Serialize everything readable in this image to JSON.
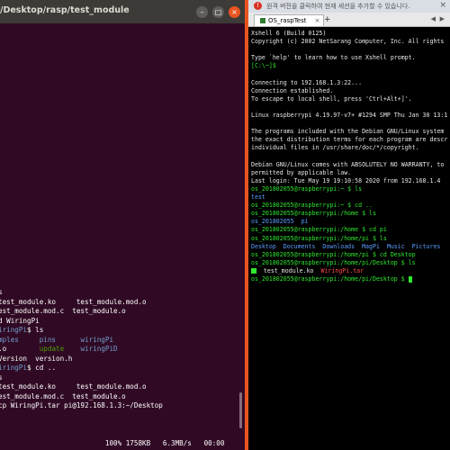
{
  "left_window": {
    "title": "/Desktop/rasp/test_module",
    "buttons": {
      "minimize": "–",
      "maximize": "□",
      "close": "×"
    }
  },
  "left_terminal": {
    "lines": [
      [
        {
          "t": "s",
          "c": "white"
        }
      ],
      [
        {
          "t": "test_module.ko     test_module.mod.o",
          "c": "white"
        }
      ],
      [
        {
          "t": "est_module.mod.c  test_module.o",
          "c": "white"
        }
      ],
      [
        {
          "t": "d WiringPi",
          "c": "white"
        }
      ],
      [
        {
          "t": "iringPi",
          "c": "blue"
        },
        {
          "t": "$ ls",
          "c": "white"
        }
      ],
      [
        {
          "t": "mples",
          "c": "blue"
        },
        {
          "t": "     ",
          "c": "white"
        },
        {
          "t": "pins",
          "c": "blue"
        },
        {
          "t": "      ",
          "c": "white"
        },
        {
          "t": "wiringPi",
          "c": "blue"
        }
      ],
      [
        {
          "t": ".o",
          "c": "white"
        },
        {
          "t": "        ",
          "c": "white"
        },
        {
          "t": "update",
          "c": "green"
        },
        {
          "t": "    ",
          "c": "white"
        },
        {
          "t": "wiringPiD",
          "c": "blue"
        }
      ],
      [
        {
          "t": "Version  version.h",
          "c": "white"
        }
      ],
      [
        {
          "t": "iringPi",
          "c": "blue"
        },
        {
          "t": "$ cd ..",
          "c": "white"
        }
      ],
      [
        {
          "t": "s",
          "c": "white"
        }
      ],
      [
        {
          "t": "test_module.ko     test_module.mod.o",
          "c": "white"
        }
      ],
      [
        {
          "t": "est_module.mod.c  test_module.o",
          "c": "white"
        }
      ],
      [
        {
          "t": "cp WiringPi.tar pi@192.168.1.3:~/Desktop",
          "c": "white"
        }
      ],
      [
        {
          "t": "",
          "c": "white"
        }
      ],
      [
        {
          "t": "                          100% 1758KB   6.3MB/s   00:00",
          "c": "white"
        }
      ]
    ]
  },
  "right_window": {
    "notice": "원격 버전을 클릭하여 현재 세션을 추가할 수 있습니다.",
    "tab_label": "OS_raspTest",
    "tab_close": "×",
    "tab_add": "+",
    "nav_left": "◀",
    "nav_right": "▶",
    "notice_close": "×"
  },
  "right_terminal": {
    "lines": [
      [
        {
          "t": "Xshell 6 (Build 0125)",
          "c": "white"
        }
      ],
      [
        {
          "t": "Copyright (c) 2002 NetSarang Computer, Inc. All rights",
          "c": "white"
        }
      ],
      [
        {
          "t": "",
          "c": "white"
        }
      ],
      [
        {
          "t": "Type `help' to learn how to use Xshell prompt.",
          "c": "white"
        }
      ],
      [
        {
          "t": "[C:\\~]$",
          "c": "green"
        }
      ],
      [
        {
          "t": "",
          "c": "white"
        }
      ],
      [
        {
          "t": "Connecting to 192.168.1.3:22...",
          "c": "white"
        }
      ],
      [
        {
          "t": "Connection established.",
          "c": "white"
        }
      ],
      [
        {
          "t": "To escape to local shell, press 'Ctrl+Alt+]'.",
          "c": "white"
        }
      ],
      [
        {
          "t": "",
          "c": "white"
        }
      ],
      [
        {
          "t": "Linux raspberrypi 4.19.97-v7+ #1294 SMP Thu Jan 30 13:1",
          "c": "white"
        }
      ],
      [
        {
          "t": "",
          "c": "white"
        }
      ],
      [
        {
          "t": "The programs included with the Debian GNU/Linux system",
          "c": "white"
        }
      ],
      [
        {
          "t": "the exact distribution terms for each program are descr",
          "c": "white"
        }
      ],
      [
        {
          "t": "individual files in /usr/share/doc/*/copyright.",
          "c": "white"
        }
      ],
      [
        {
          "t": "",
          "c": "white"
        }
      ],
      [
        {
          "t": "Debian GNU/Linux comes with ABSOLUTELY NO WARRANTY, to",
          "c": "white"
        }
      ],
      [
        {
          "t": "permitted by applicable law.",
          "c": "white"
        }
      ],
      [
        {
          "t": "Last login: Tue May 19 19:10:58 2020 from 192.168.1.4",
          "c": "white"
        }
      ],
      [
        {
          "t": "os_201802055@raspberrypi:~ $ ls",
          "c": "green"
        }
      ],
      [
        {
          "t": "test",
          "c": "blue"
        }
      ],
      [
        {
          "t": "os_201802055@raspberrypi:~ $ cd ..",
          "c": "green"
        }
      ],
      [
        {
          "t": "os_201802055@raspberrypi:/home $ ls",
          "c": "green"
        }
      ],
      [
        {
          "t": "os_201802055  pi",
          "c": "blue"
        }
      ],
      [
        {
          "t": "os_201802055@raspberrypi:/home $ cd pi",
          "c": "green"
        }
      ],
      [
        {
          "t": "os_201802055@raspberrypi:/home/pi $ ls",
          "c": "green"
        }
      ],
      [
        {
          "t": "Desktop  Documents  Downloads  MagPi  Music  Pictures",
          "c": "blue"
        }
      ],
      [
        {
          "t": "os_201802055@raspberrypi:/home/pi $ cd Desktop",
          "c": "green"
        }
      ],
      [
        {
          "t": "os_201802055@raspberrypi:/home/pi/Desktop $ ls",
          "c": "green"
        }
      ],
      [
        {
          "t": "BOX",
          "c": "box"
        },
        {
          "t": "  test_module.ko  ",
          "c": "white"
        },
        {
          "t": "WiringPi.tar",
          "c": "red"
        }
      ],
      [
        {
          "t": "os_201802055@raspberrypi:/home/pi/Desktop $ ",
          "c": "green"
        },
        {
          "t": "CURSOR",
          "c": "cursor"
        }
      ]
    ]
  }
}
